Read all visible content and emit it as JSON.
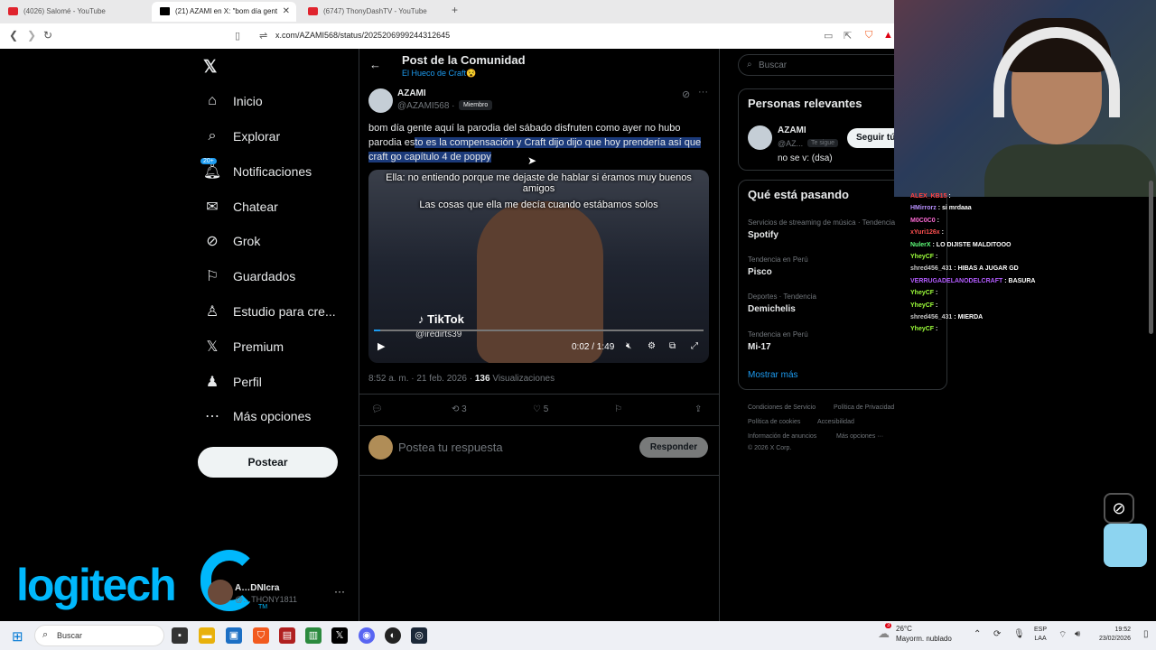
{
  "browser": {
    "tabs": [
      {
        "label": "(4026) Salomé - YouTube"
      },
      {
        "label": "(21) AZAMI en X: \"bom día gent"
      },
      {
        "label": "(6747) ThonyDashTV - YouTube"
      }
    ],
    "url": "x.com/AZAMI568/status/2025206999244312645"
  },
  "sidebar": {
    "items": [
      {
        "label": "Inicio",
        "icon": "home-icon"
      },
      {
        "label": "Explorar",
        "icon": "search-icon"
      },
      {
        "label": "Notificaciones",
        "icon": "bell-icon",
        "badge": "20+"
      },
      {
        "label": "Chatear",
        "icon": "mail-icon"
      },
      {
        "label": "Grok",
        "icon": "grok-icon"
      },
      {
        "label": "Guardados",
        "icon": "bookmark-icon"
      },
      {
        "label": "Estudio para cre...",
        "icon": "studio-icon"
      },
      {
        "label": "Premium",
        "icon": "x-icon"
      },
      {
        "label": "Perfil",
        "icon": "person-icon"
      },
      {
        "label": "Más opciones",
        "icon": "more-icon"
      }
    ],
    "post_label": "Postear",
    "account": {
      "name": "A…DNIcra",
      "handle": "@…THONY1811"
    }
  },
  "overlay": {
    "logitech": "logitech",
    "tm": "TM"
  },
  "post": {
    "header_title": "Post de la Comunidad",
    "community": "El Hueco de Craft😵",
    "author_name": "AZAMI",
    "author_handle": "@AZAMI568 ·",
    "member_badge": "Miembro",
    "text_plain": "bom día gente aquí la parodia del sábado disfruten como ayer no hubo parodia es",
    "text_highlight": "to es la compensación y Craft dijo dijo que hoy prendería así que craft go capítulo 4 de poppy",
    "video": {
      "caption1": "Ella: no entiendo porque me dejaste de hablar si éramos muy buenos amigos",
      "caption2": "Las cosas que ella me decía cuando estábamos solos",
      "brand": "TikTok",
      "handle": "@iredirts39",
      "time": "0:02 / 1:49",
      "progress": 0.02
    },
    "time_date": "8:52 a. m. · 21 feb. 2026 ·",
    "views_count": "136",
    "views_label": "Visualizaciones",
    "retweets": "3",
    "likes": "5",
    "reply_placeholder": "Postea tu respuesta",
    "reply_button": "Responder"
  },
  "right": {
    "search_placeholder": "Buscar",
    "relevant_title": "Personas relevantes",
    "relevant": {
      "name": "AZAMI",
      "handle": "@AZ...",
      "follows_you": "Te sigue",
      "bio": "no se v: (dsa)",
      "follow_label": "Seguir tú"
    },
    "trends_title": "Qué está pasando",
    "trends": [
      {
        "category": "Servicios de streaming de música · Tendencia",
        "name": "Spotify"
      },
      {
        "category": "Tendencia en Perú",
        "name": "Pisco"
      },
      {
        "category": "Deportes · Tendencia",
        "name": "Demichelis"
      },
      {
        "category": "Tendencia en Perú",
        "name": "Mi-17"
      }
    ],
    "show_more": "Mostrar más",
    "footer": [
      "Condiciones de Servicio",
      "Política de Privacidad",
      "Política de cookies",
      "Accesibilidad",
      "Información de anuncios",
      "Más opciones ···",
      "© 2026 X Corp."
    ]
  },
  "chat": [
    {
      "user": "ALEX_KB15",
      "msg": "",
      "color": "#ff4040"
    },
    {
      "user": "HMirrorz",
      "msg": "si mrdaaa",
      "color": "#b890ff"
    },
    {
      "user": "M0C0C0",
      "msg": "",
      "color": "#ff6ad5"
    },
    {
      "user": "xYuri126x",
      "msg": "",
      "color": "#ff5050"
    },
    {
      "user": "NulerX",
      "msg": "LO DIJISTE MALDITOOO",
      "color": "#5fff7a"
    },
    {
      "user": "YheyCF",
      "msg": "",
      "color": "#9dff3a"
    },
    {
      "user": "shred456_431",
      "msg": "HIBAS A JUGAR GD",
      "color": "#c8c8c8"
    },
    {
      "user": "VERRUGADELANODELCRAFT",
      "msg": "BASURA",
      "color": "#b35cff"
    },
    {
      "user": "YheyCF",
      "msg": "",
      "color": "#9dff3a"
    },
    {
      "user": "YheyCF",
      "msg": "",
      "color": "#9dff3a"
    },
    {
      "user": "shred456_431",
      "msg": "MIERDA",
      "color": "#c8c8c8"
    },
    {
      "user": "YheyCF",
      "msg": "",
      "color": "#9dff3a"
    }
  ],
  "taskbar": {
    "search": "Buscar",
    "weather_temp": "26°C",
    "weather_desc": "Mayorm. nublado",
    "weather_badge": "3",
    "lang1": "ESP",
    "lang2": "LAA",
    "time": "19:52",
    "date": "23/02/2026"
  }
}
